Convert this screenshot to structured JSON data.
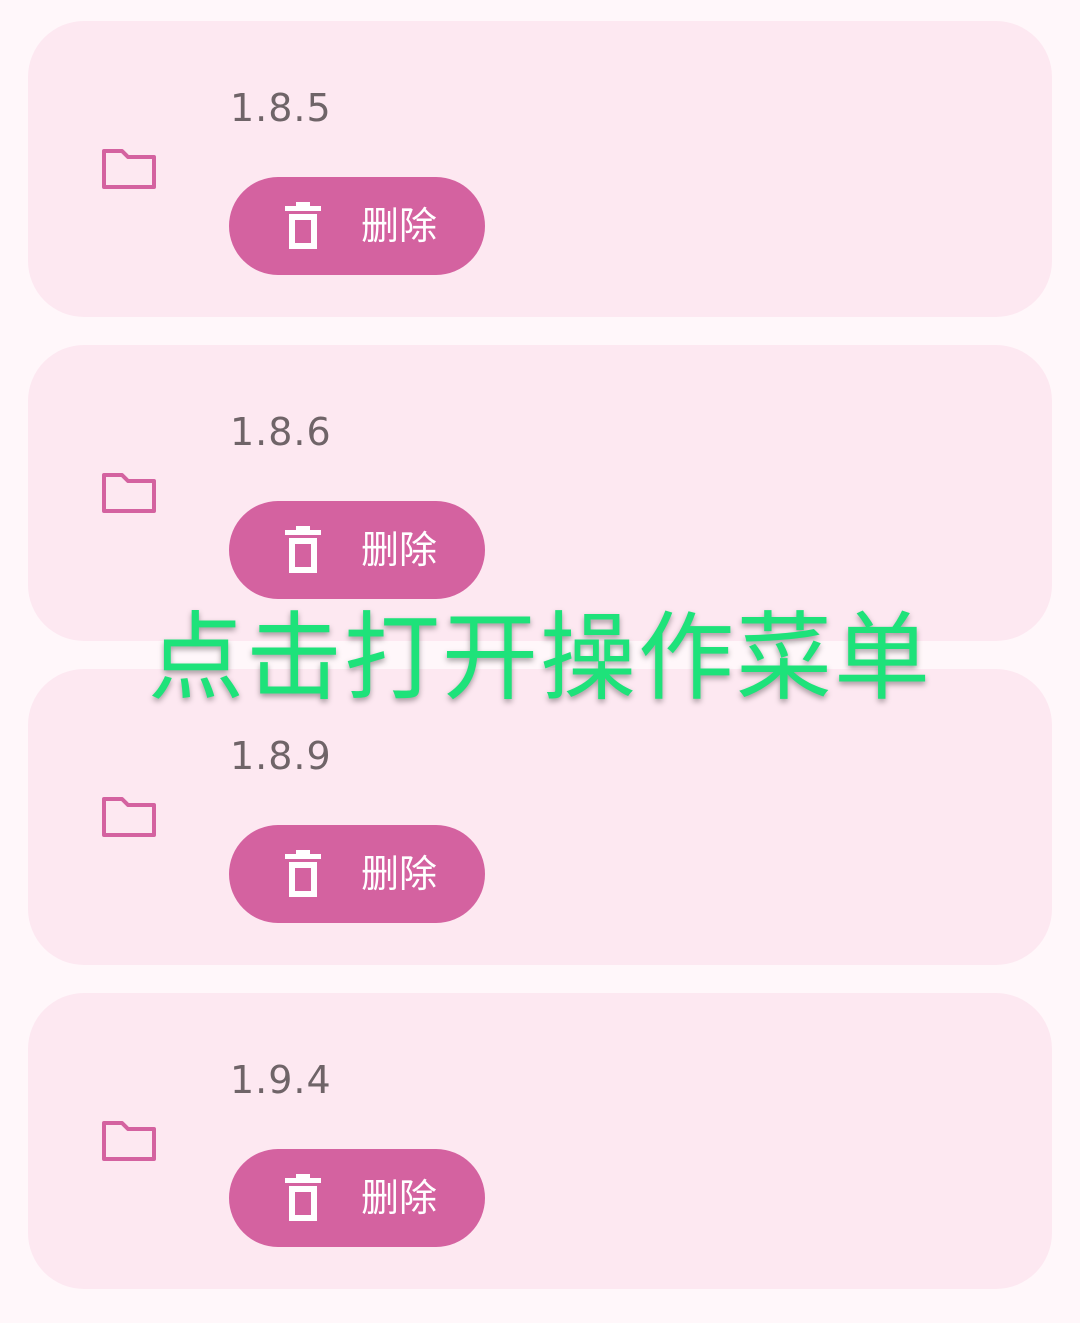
{
  "colors": {
    "page_background": "#fff7fa",
    "card_background": "#fde8f1",
    "accent": "#d462a0",
    "overlay_text": "#1ee27a",
    "version_text": "#6f6468"
  },
  "items": [
    {
      "version": "1.8.5",
      "delete_label": "删除",
      "icon": "folder-icon"
    },
    {
      "version": "1.8.6",
      "delete_label": "删除",
      "icon": "folder-icon"
    },
    {
      "version": "1.8.9",
      "delete_label": "删除",
      "icon": "folder-icon"
    },
    {
      "version": "1.9.4",
      "delete_label": "删除",
      "icon": "folder-icon"
    }
  ],
  "overlay": {
    "hint": "点击打开操作菜单"
  }
}
